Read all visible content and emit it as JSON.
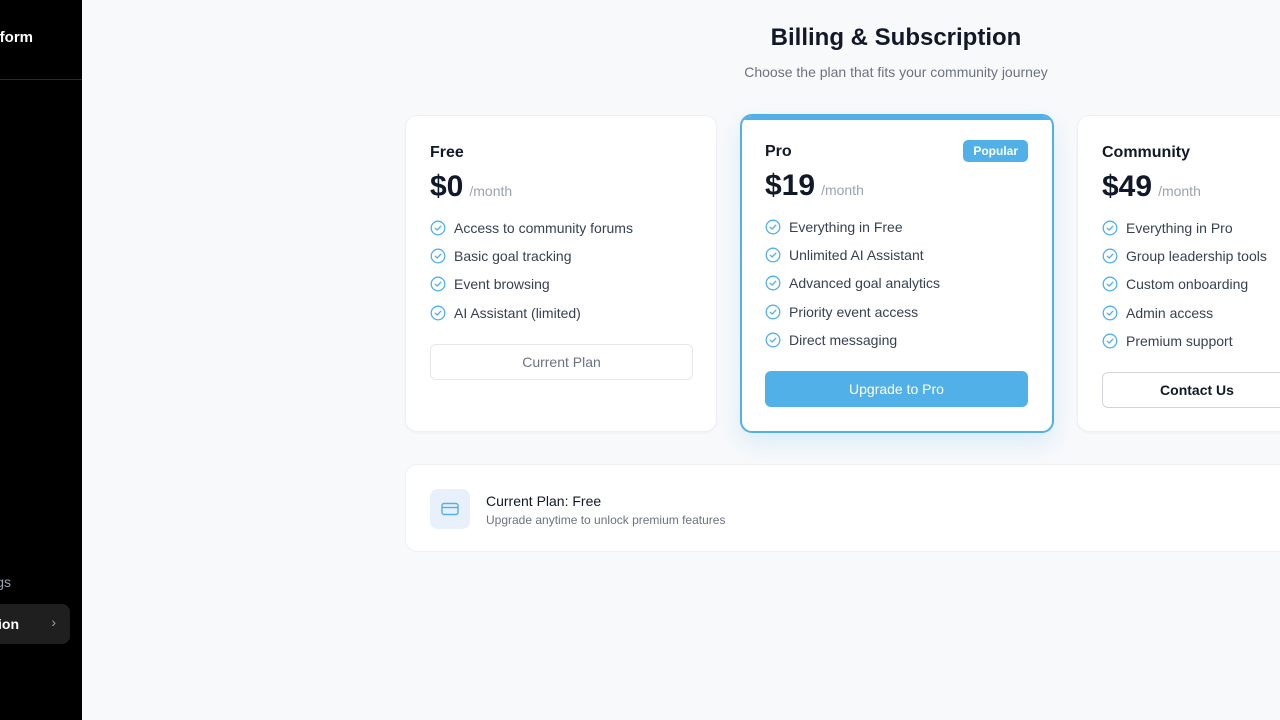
{
  "sidebar": {
    "brand": "form",
    "settings_label": "gs",
    "active_label": "ion"
  },
  "header": {
    "title": "Billing & Subscription",
    "subtitle": "Choose the plan that fits your community journey"
  },
  "plans": [
    {
      "name": "Free",
      "price": "$0",
      "period": "/month",
      "features": [
        "Access to community forums",
        "Basic goal tracking",
        "Event browsing",
        "AI Assistant (limited)"
      ],
      "button": "Current Plan"
    },
    {
      "name": "Pro",
      "badge": "Popular",
      "price": "$19",
      "period": "/month",
      "features": [
        "Everything in Free",
        "Unlimited AI Assistant",
        "Advanced goal analytics",
        "Priority event access",
        "Direct messaging"
      ],
      "button": "Upgrade to Pro"
    },
    {
      "name": "Community",
      "price": "$49",
      "period": "/month",
      "features": [
        "Everything in Pro",
        "Group leadership tools",
        "Custom onboarding",
        "Admin access",
        "Premium support"
      ],
      "button": "Contact Us"
    }
  ],
  "current_plan": {
    "title": "Current Plan: Free",
    "description": "Upgrade anytime to unlock premium features",
    "icon": "credit-card-icon"
  },
  "colors": {
    "accent": "#52b0e8",
    "sidebar_bg": "#000000",
    "page_bg": "#f8f9fb"
  }
}
